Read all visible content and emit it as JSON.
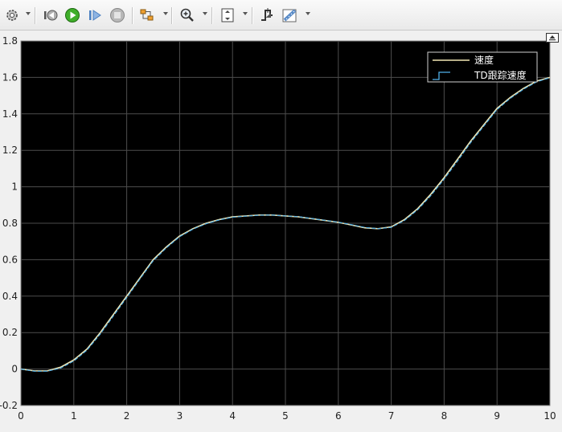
{
  "toolbar": {
    "buttons": [
      {
        "icon": "gear-icon"
      },
      {
        "icon": "step-back-icon"
      },
      {
        "icon": "run-icon"
      },
      {
        "icon": "step-forward-icon"
      },
      {
        "icon": "stop-icon"
      },
      {
        "icon": "signal-select-icon"
      },
      {
        "icon": "zoom-in-icon"
      },
      {
        "icon": "fit-to-view-icon"
      },
      {
        "icon": "triggers-icon"
      },
      {
        "icon": "measurement-icon"
      }
    ]
  },
  "colors": {
    "plot_bg": "#000000",
    "grid": "#4d4d4d",
    "axis_text": "#ffffff",
    "series_1": "#f2e7b4",
    "series_2": "#4fb0ea"
  },
  "chart_data": {
    "type": "line",
    "xlim": [
      0,
      10
    ],
    "ylim": [
      -0.2,
      1.8
    ],
    "xticks": [
      "0",
      "1",
      "2",
      "3",
      "4",
      "5",
      "6",
      "7",
      "8",
      "9",
      "10"
    ],
    "yticks": [
      "-0.2",
      "0",
      "0.2",
      "0.4",
      "0.6",
      "0.8",
      "1",
      "1.2",
      "1.4",
      "1.6",
      "1.8"
    ],
    "grid": true,
    "legend_position": "top-right",
    "series": [
      {
        "name": "速度",
        "x": [
          0,
          0.25,
          0.5,
          0.75,
          1,
          1.25,
          1.5,
          1.75,
          2,
          2.25,
          2.5,
          2.75,
          3,
          3.25,
          3.5,
          3.75,
          4,
          4.25,
          4.5,
          4.75,
          5,
          5.25,
          5.5,
          5.75,
          6,
          6.25,
          6.5,
          6.75,
          7,
          7.25,
          7.5,
          7.75,
          8,
          8.25,
          8.5,
          8.75,
          9,
          9.25,
          9.5,
          9.75,
          10
        ],
        "y": [
          0,
          -0.01,
          -0.01,
          0.01,
          0.05,
          0.11,
          0.2,
          0.3,
          0.4,
          0.5,
          0.6,
          0.67,
          0.73,
          0.77,
          0.8,
          0.82,
          0.835,
          0.84,
          0.845,
          0.845,
          0.84,
          0.835,
          0.825,
          0.815,
          0.805,
          0.79,
          0.775,
          0.77,
          0.78,
          0.82,
          0.88,
          0.96,
          1.05,
          1.15,
          1.25,
          1.34,
          1.43,
          1.49,
          1.54,
          1.58,
          1.6
        ]
      },
      {
        "name": "TD跟踪速度",
        "x": [
          0,
          0.25,
          0.5,
          0.75,
          1,
          1.25,
          1.5,
          1.75,
          2,
          2.25,
          2.5,
          2.75,
          3,
          3.25,
          3.5,
          3.75,
          4,
          4.25,
          4.5,
          4.75,
          5,
          5.25,
          5.5,
          5.75,
          6,
          6.25,
          6.5,
          6.75,
          7,
          7.25,
          7.5,
          7.75,
          8,
          8.25,
          8.5,
          8.75,
          9,
          9.25,
          9.5,
          9.75,
          10
        ],
        "y": [
          0,
          -0.012,
          -0.012,
          0.005,
          0.044,
          0.104,
          0.192,
          0.292,
          0.392,
          0.494,
          0.594,
          0.665,
          0.726,
          0.767,
          0.797,
          0.818,
          0.833,
          0.839,
          0.844,
          0.845,
          0.84,
          0.836,
          0.826,
          0.816,
          0.806,
          0.792,
          0.777,
          0.77,
          0.777,
          0.815,
          0.874,
          0.952,
          1.042,
          1.14,
          1.242,
          1.333,
          1.424,
          1.485,
          1.535,
          1.576,
          1.598
        ]
      }
    ]
  }
}
